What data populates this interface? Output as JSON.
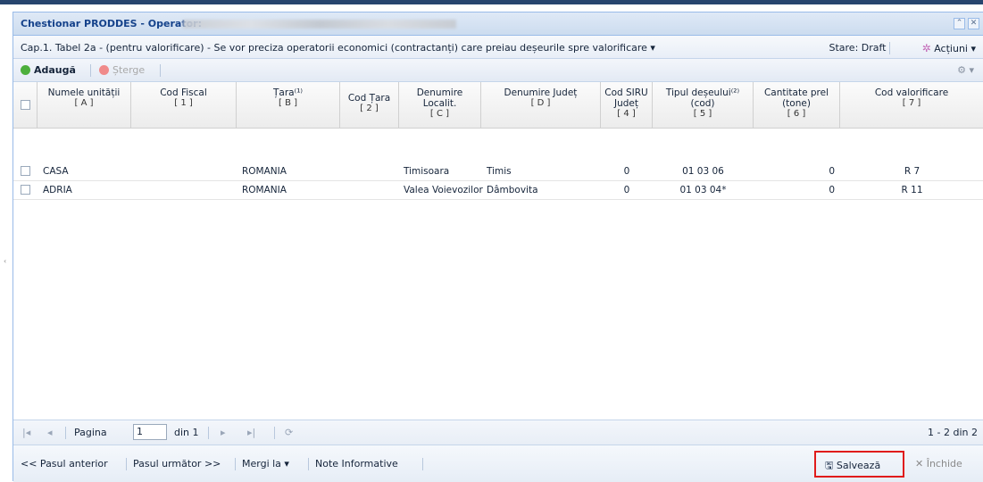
{
  "window": {
    "title": "Chestionar PRODDES - Operator:",
    "collapse_icon": "double-chevron-up-icon",
    "close_icon": "close-icon"
  },
  "subheader": {
    "caption": "Cap.1. Tabel 2a - (pentru valorificare) - Se vor preciza operatorii economici (contractanți) care preiau deșeurile spre valorificare ▾",
    "state": "Stare: Draft",
    "actions": "Acțiuni ▾"
  },
  "toolbar": {
    "add": "Adaugă",
    "delete": "Șterge"
  },
  "columns": [
    {
      "name": "Numele unității",
      "code": "[ A ]"
    },
    {
      "name": "Cod Fiscal",
      "code": "[ 1 ]"
    },
    {
      "name": "Țara⁽¹⁾",
      "code": "[ B ]"
    },
    {
      "name": "Cod Țara",
      "code": "[ 2 ]"
    },
    {
      "name": "Denumire Localit.",
      "code": "[ C ]"
    },
    {
      "name": "Denumire Județ",
      "code": "[ D ]"
    },
    {
      "name": "Cod SIRU Județ",
      "code": "[ 4 ]"
    },
    {
      "name": "Tipul deșeului⁽²⁾ (cod)",
      "code": "[ 5 ]"
    },
    {
      "name": "Cantitate prel (tone)",
      "code": "[ 6 ]"
    },
    {
      "name": "Cod valorificare",
      "code": "[ 7 ]"
    }
  ],
  "rows": [
    {
      "name": "CASA",
      "fiscal": "",
      "country": "ROMANIA",
      "country_code": "",
      "locality": "Timisoara",
      "county": "Timis",
      "siruta": "0",
      "waste_code": "01 03 06",
      "quantity": "0",
      "recovery": "R 7"
    },
    {
      "name": "ADRIA",
      "fiscal": "",
      "country": "ROMANIA",
      "country_code": "",
      "locality": "Valea Voievozilor",
      "county": "Dâmbovita",
      "siruta": "0",
      "waste_code": "01 03 04*",
      "quantity": "0",
      "recovery": "R 11"
    }
  ],
  "pager": {
    "page_label": "Pagina",
    "page_value": "1",
    "of_label": "din 1",
    "summary": "1 - 2 din 2"
  },
  "footer": {
    "prev": "<< Pasul anterior",
    "next": "Pasul următor >>",
    "goto": "Mergi la ▾",
    "notes": "Note Informative",
    "save": "Salvează",
    "close": "Închide"
  },
  "colors": {
    "accent": "#27456e",
    "header_text": "#15428b",
    "highlight": "#e01b1b"
  }
}
